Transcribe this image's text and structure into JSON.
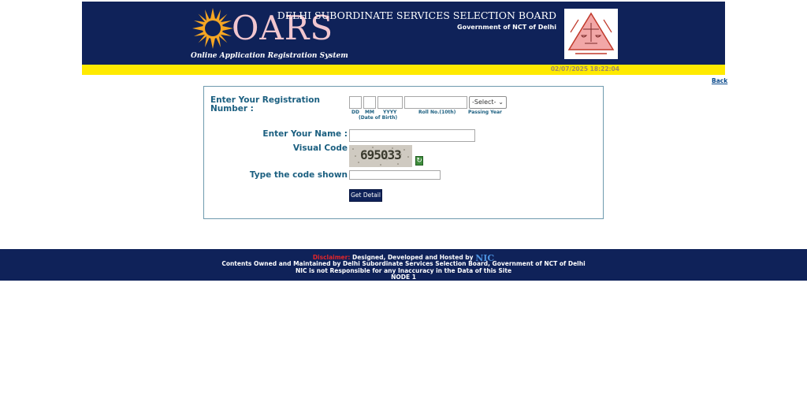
{
  "header": {
    "logo_text": "OARS",
    "logo_subtitle": "Online Application Registration System",
    "board_title": "DELHI SUBORDINATE SERVICES SELECTION BOARD",
    "board_subtitle": "Government of NCT of Delhi",
    "timestamp": "02/07/2025 18:22:04"
  },
  "nav": {
    "back_label": "Back"
  },
  "form": {
    "registration_label": "Enter Your Registration Number :",
    "dob": {
      "dd": "DD",
      "mm": "MM",
      "yyyy": "YYYY",
      "caption": "(Date of Birth)"
    },
    "roll_caption": "Roll No.(10th)",
    "passing_year_caption": "Passing Year",
    "passing_year_selected": "-Select-",
    "name_label": "Enter Your Name :",
    "visual_code_label": "Visual Code",
    "captcha_value": "695033",
    "type_code_label": "Type the code shown",
    "submit_label": "Get Detail"
  },
  "footer": {
    "disclaimer_label": "Disclaimer:",
    "designed_by": "Designed, Developed and Hosted by",
    "nic_logo": "NIC",
    "line2": "Contents Owned and Maintained by Delhi Subordinate Services Selection Board, Government of NCT of Delhi",
    "line3": "NIC is not Responsible for any Inaccuracy in the Data of this Site",
    "node": "NODE 1"
  },
  "colors": {
    "navy": "#0f2259",
    "yellow": "#ffea00",
    "label_blue": "#1b5f80",
    "disclaimer_red": "#e0252a"
  }
}
